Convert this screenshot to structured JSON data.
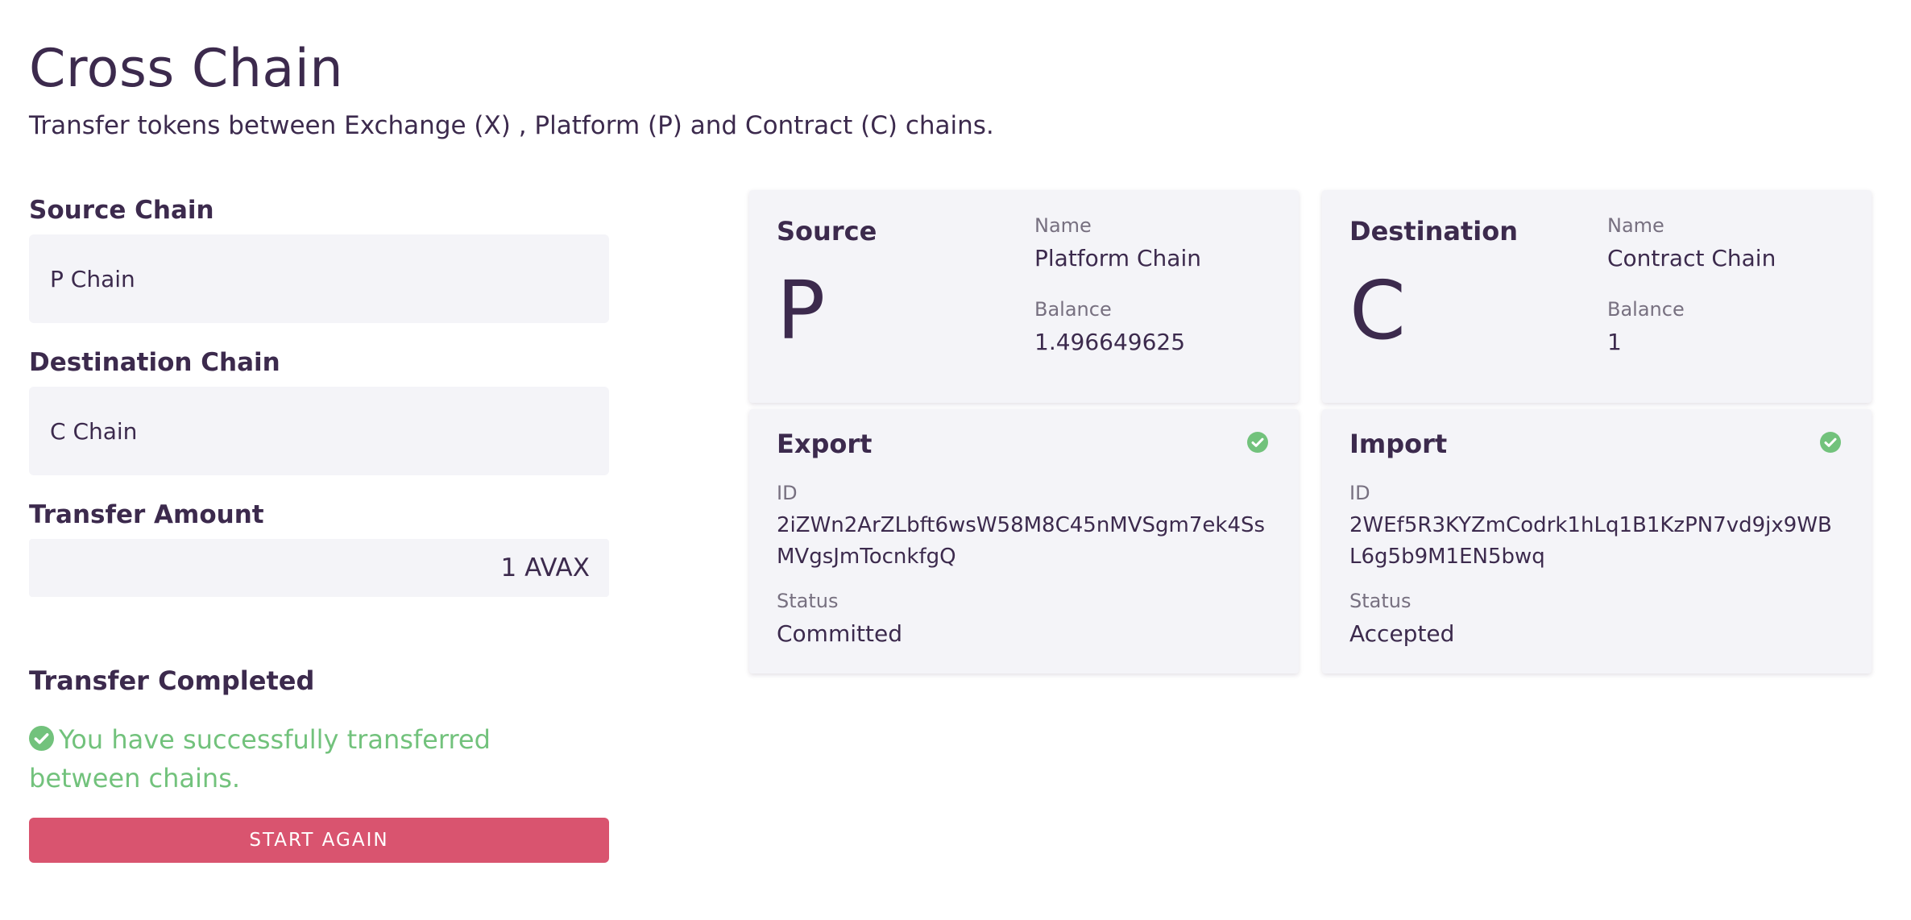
{
  "header": {
    "title": "Cross Chain",
    "subtitle": "Transfer tokens between Exchange (X) , Platform (P) and Contract (C) chains."
  },
  "form": {
    "source_label": "Source Chain",
    "source_value": "P Chain",
    "destination_label": "Destination Chain",
    "destination_value": "C Chain",
    "amount_label": "Transfer Amount",
    "amount_value": "1 AVAX"
  },
  "result": {
    "title": "Transfer Completed",
    "message": "You have successfully transferred between chains.",
    "button_label": "START AGAIN"
  },
  "source_card": {
    "title": "Source",
    "letter": "P",
    "name_label": "Name",
    "name_value": "Platform Chain",
    "balance_label": "Balance",
    "balance_value": "1.496649625"
  },
  "destination_card": {
    "title": "Destination",
    "letter": "C",
    "name_label": "Name",
    "name_value": "Contract Chain",
    "balance_label": "Balance",
    "balance_value": "1"
  },
  "export_card": {
    "title": "Export",
    "id_label": "ID",
    "id_value": "2iZWn2ArZLbft6wsW58M8C45nMVSgm7ek4SsMVgsJmTocnkfgQ",
    "status_label": "Status",
    "status_value": "Committed"
  },
  "import_card": {
    "title": "Import",
    "id_label": "ID",
    "id_value": "2WEf5R3KYZmCodrk1hLq1B1KzPN7vd9jx9WBL6g5b9M1EN5bwq",
    "status_label": "Status",
    "status_value": "Accepted"
  },
  "colors": {
    "text": "#3c2a4d",
    "success": "#72c27c",
    "button": "#d9546f",
    "card_bg": "#f4f4f8"
  },
  "icons": {
    "success": "check-circle-icon"
  }
}
